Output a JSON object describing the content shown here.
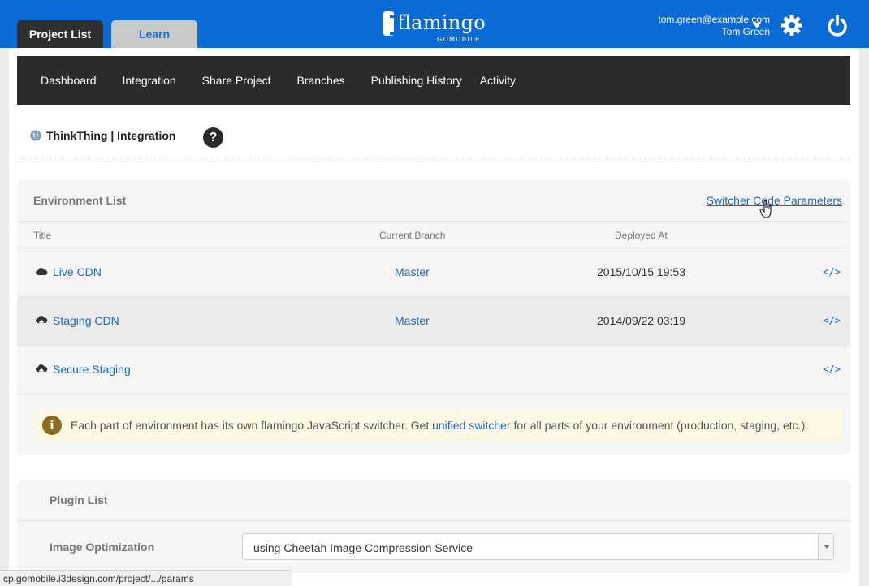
{
  "tabs": {
    "project_list": "Project List",
    "learn": "Learn"
  },
  "logo": {
    "name": "flamingo",
    "sub": "GOMOBILE"
  },
  "user": {
    "email": "tom.green@example.com",
    "name": "Tom Green"
  },
  "subnav": [
    "Dashboard",
    "Integration",
    "Share Project",
    "Branches",
    "Publishing History",
    "Activity"
  ],
  "breadcrumb": "ThinkThing | Integration",
  "help": "?",
  "environment": {
    "title": "Environment List",
    "link": "Switcher Code Parameters",
    "columns": {
      "title": "Title",
      "branch": "Current Branch",
      "deployed": "Deployed At"
    },
    "rows": [
      {
        "title": "Live CDN",
        "branch": "Master",
        "deployed": "2015/10/15 19:53",
        "code": "</>",
        "icon": "cloud-icon"
      },
      {
        "title": "Staging CDN",
        "branch": "Master",
        "deployed": "2014/09/22 03:19",
        "code": "</>",
        "icon": "cloud-upload-icon"
      },
      {
        "title": "Secure Staging",
        "branch": "",
        "deployed": "",
        "code": "</>",
        "icon": "cloud-upload-icon"
      }
    ],
    "notice": {
      "before": "Each part of environment has its own flamingo JavaScript switcher. Get",
      "link": "unified switcher",
      "after": "for all parts of your environment (production, staging, etc.)."
    }
  },
  "plugins": {
    "title": "Plugin List",
    "label": "Image Optimization",
    "selected": "using Cheetah Image Compression Service"
  },
  "status_url": "cp.gomobile.i3design.com/project/.../params",
  "colors": {
    "brand_blue": "#0a6bd6",
    "dark": "#2b2b2b",
    "link": "#1f66c1"
  }
}
